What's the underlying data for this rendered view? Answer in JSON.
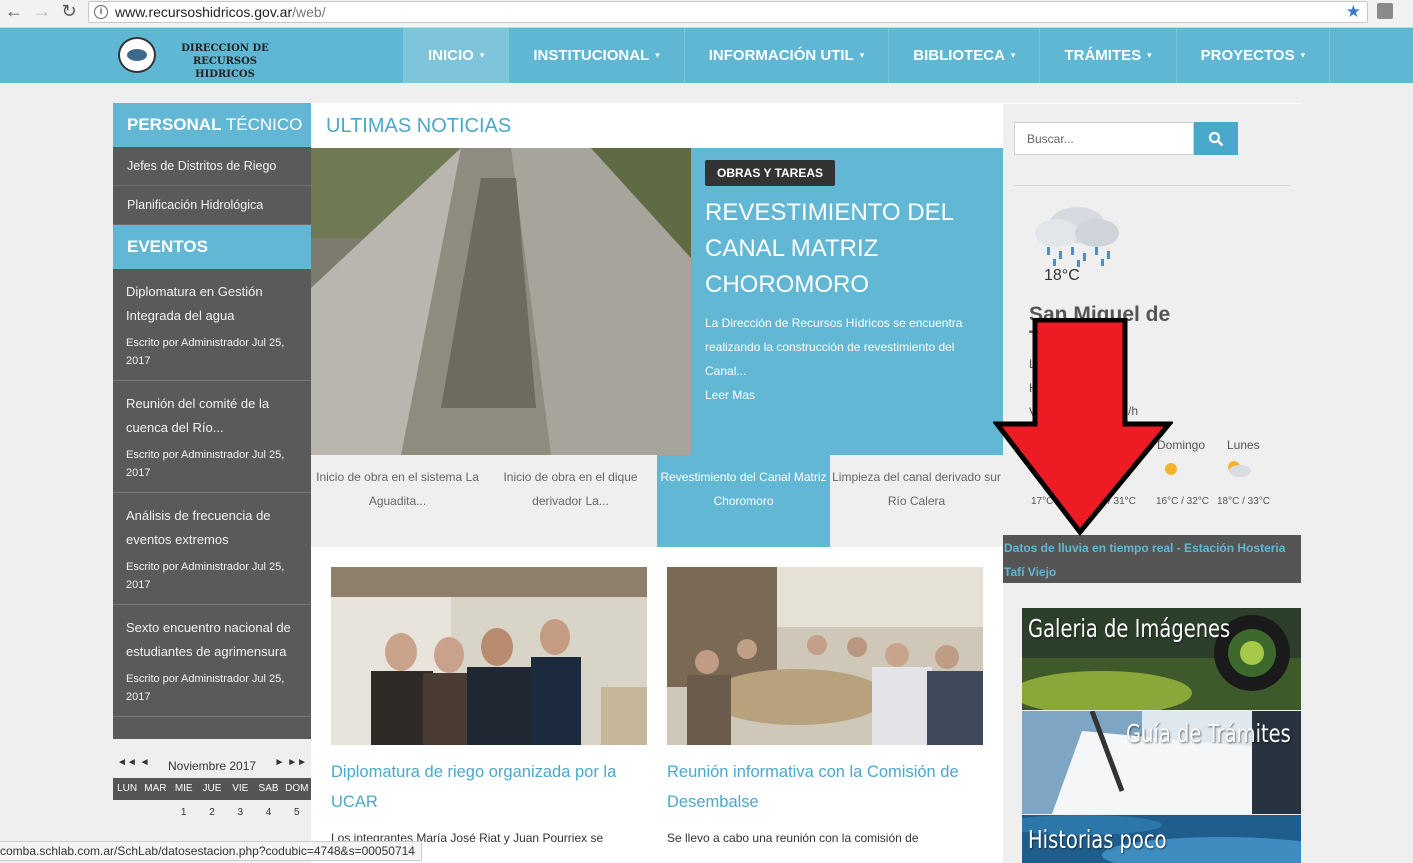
{
  "browser": {
    "url_host": "www.recursoshidricos.gov.ar",
    "url_path": "/web/",
    "status_url": "comba.schlab.com.ar/SchLab/datosestacion.php?codubic=4748&s=00050714"
  },
  "header": {
    "logo_line1": "DIRECCION DE",
    "logo_line2": "RECURSOS HIDRICOS",
    "menu": [
      {
        "label": "INICIO"
      },
      {
        "label": "INSTITUCIONAL"
      },
      {
        "label": "INFORMACIÓN UTIL"
      },
      {
        "label": "BIBLIOTECA"
      },
      {
        "label": "TRÁMITES"
      },
      {
        "label": "PROYECTOS"
      }
    ],
    "caret": "▾"
  },
  "sidebar": {
    "personal_bold": "PERSONAL",
    "personal_rest": " TÉCNICO",
    "links": [
      "Jefes de Distritos de Riego",
      "Planificación Hidrológica"
    ],
    "events_title": "EVENTOS",
    "events": [
      {
        "title": "Diplomatura en Gestión Integrada del agua",
        "meta": "Escrito por Administrador Jul 25, 2017"
      },
      {
        "title": "Reunión del comité de la cuenca del Río...",
        "meta": "Escrito por Administrador Jul 25, 2017"
      },
      {
        "title": "Análisis de frecuencia de eventos extremos",
        "meta": "Escrito por Administrador Jul 25, 2017"
      },
      {
        "title": "Sexto encuentro nacional de estudiantes de agrimensura",
        "meta": "Escrito por Administrador Jul 25, 2017"
      }
    ]
  },
  "calendar": {
    "month": "Noviembre 2017",
    "prev": "◄◄ ◄",
    "next": "► ►►",
    "days": [
      "LUN",
      "MAR",
      "MIE",
      "JUE",
      "VIE",
      "SAB",
      "DOM"
    ],
    "row1": [
      "",
      "",
      "1",
      "2",
      "3",
      "4",
      "5"
    ]
  },
  "news": {
    "section_title": "ULTIMAS NOTICIAS",
    "hero_badge": "OBRAS Y TAREAS",
    "hero_title": "REVESTIMIENTO DEL CANAL MATRIZ CHOROMORO",
    "hero_text": "La Dirección de Recursos Hídricos se encuentra realizando la construcción de revestimiento del Canal...",
    "hero_more": "Leer Mas",
    "tabs": [
      "Inicio de obra en el sistema La Aguadita...",
      "Inicio de obra en el dique derivador La...",
      "Revestimiento del Canal Matriz Choromoro",
      "Limpieza del canal derivado sur Río Calera"
    ],
    "cards": [
      {
        "title": "Diplomatura de riego organizada por la UCAR",
        "text": "Los integrantes María José Riat y Juan Pourriex se"
      },
      {
        "title": "Reunión informativa con la Comisión de Desembalse",
        "text": "Se llevo a cabo una reunión con la comisión de"
      }
    ]
  },
  "right": {
    "search_placeholder": "Buscar...",
    "weather_temp": "18°C",
    "city": "San Miguel de Tucumán",
    "wind_unit": "m/h",
    "forecast": [
      {
        "day": "Domingo",
        "temps": "16°C / 32°C"
      },
      {
        "day": "Lunes",
        "temps": "18°C / 33°C"
      }
    ],
    "forecast_partial": [
      "17°C",
      "C / 31°C"
    ],
    "rain_link": "Datos de lluvia en tiempo real - Estación Hosteria Tafí Viejo",
    "banners": [
      "Galeria de Imágenes",
      "Guía de Trámites",
      "Historias poco"
    ]
  },
  "colors": {
    "accent": "#5fb7d3",
    "dark_panel": "#5a5a5a",
    "arrow": "#ed1c24"
  }
}
